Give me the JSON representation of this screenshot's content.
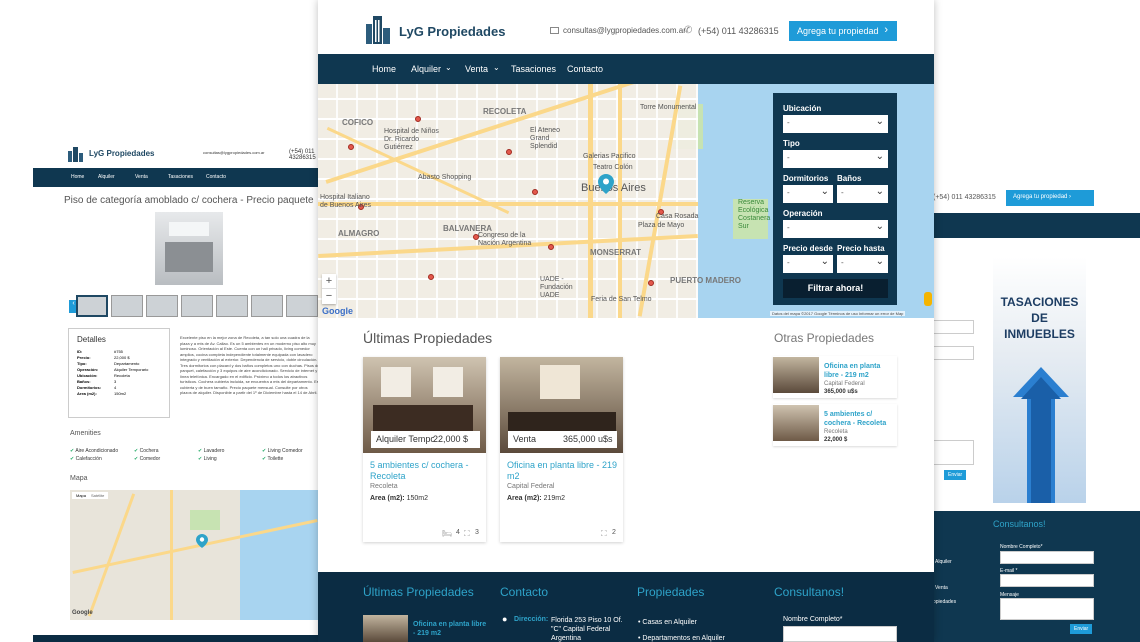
{
  "brand": {
    "name": "LyG Propiedades"
  },
  "header": {
    "email": "consultas@lygpropiedades.com.ar",
    "phone": "(+54) 011 43286315",
    "cta": "Agrega tu propiedad"
  },
  "nav": {
    "items": [
      "Home",
      "Alquiler",
      "Venta",
      "Tasaciones",
      "Contacto"
    ]
  },
  "search": {
    "ubicacion_label": "Ubicación",
    "tipo_label": "Tipo",
    "dormitorios_label": "Dormitorios",
    "banos_label": "Baños",
    "operacion_label": "Operación",
    "precio_desde_label": "Precio desde",
    "precio_hasta_label": "Precio hasta",
    "select_value": "-",
    "submit": "Filtrar ahora!"
  },
  "map": {
    "labels": [
      "Torre Monumental",
      "El Ateneo Grand Splendid",
      "Galerias Pacifico",
      "Teatro Colón",
      "RECOLETA",
      "Hospital de Niños Dr. Ricardo Gutiérrez",
      "Abasto Shopping",
      "Buenos Aires",
      "Casa Rosada",
      "Plaza de Mayo",
      "Congreso de la Nación Argentina",
      "BALVANERA",
      "ALMAGRO",
      "MONSERRAT",
      "UADE - Fundación UADE",
      "Feria de San Telmo",
      "COFICO",
      "Hospital Italiano de Buenos Aires",
      "PUERTO MADERO",
      "Reserva Ecológica Costanera Sur"
    ],
    "attribution": "Datos del mapa ©2017 Google  Términos de uso  Informar un error de Map",
    "google": "Google",
    "zoom_in": "+",
    "zoom_out": "−"
  },
  "latest": {
    "title": "Últimas Propiedades",
    "cards": [
      {
        "tag": "Alquiler Tempo",
        "price": "22,000 $",
        "title": "5 ambientes c/ cochera - Recoleta",
        "location": "Recoleta",
        "area_label": "Area (m2):",
        "area": "150m2",
        "beds": "4",
        "baths": "3"
      },
      {
        "tag": "Venta",
        "price": "365,000 u$s",
        "title": "Oficina en planta libre - 219 m2",
        "location": "Capital Federal",
        "area_label": "Area (m2):",
        "area": "219m2",
        "baths": "2"
      }
    ]
  },
  "others": {
    "title": "Otras Propiedades",
    "items": [
      {
        "title": "Oficina en planta libre - 219 m2",
        "location": "Capital Federal",
        "price": "365,000 u$s"
      },
      {
        "title": "5 ambientes c/ cochera - Recoleta",
        "location": "Recoleta",
        "price": "22,000 $"
      }
    ]
  },
  "footer": {
    "latest_title": "Últimas Propiedades",
    "contact_title": "Contacto",
    "props_title": "Propiedades",
    "consult_title": "Consultanos!",
    "latest_item": "Oficina en planta libre - 219 m2",
    "address_label": "Dirección:",
    "address": "Florida 253 Piso 10 Of. \"C\" Capital Federal Argentina",
    "props": [
      "Casas en Alquiler",
      "Departamentos en Alquiler"
    ],
    "name_label": "Nombre Completo*"
  },
  "left_page": {
    "title": "Piso de categoría amoblado c/ cochera - Precio paquete",
    "details_title": "Detalles",
    "details": [
      {
        "k": "ID:",
        "v": "#755"
      },
      {
        "k": "Precio:",
        "v": "22,000 $"
      },
      {
        "k": "Tipo:",
        "v": "Departamento"
      },
      {
        "k": "Operación:",
        "v": "Alquiler Temporario"
      },
      {
        "k": "Ubicación:",
        "v": "Recoleta"
      },
      {
        "k": "Baños:",
        "v": "3"
      },
      {
        "k": "Dormitorios:",
        "v": "4"
      },
      {
        "k": "Area (m2):",
        "v": "150m2"
      }
    ],
    "description": "Excelente piso en la mejor zona de Recoleta, a tan solo una cuadra de la plaza y a mts de Av. Callao. Es un 5 ambientes en un moderno piso alto muy luminoso. Orientación al Este. Cuenta con un hall privado, living comedor amplios, cocina completa independiente totalmente equipada con lavadero integrado y ventilación al exterior. Dependencia de servicio, doble circulación. Tres dormitorios con placard y dos baños completos uno con duchas. Pisos de parquet, calefacción y 3 equipos de aire acondicionado. Servicio de internet y línea telefónica. Encargado en el edificio. Próximo a todos los atractivos turísticos. Cochera cubierta incluida, se encuentra a mts del departamento. Es cubierta y de buen tamaño. Precio paquete mensual. Consulte por otros plazos de alquiler. Disponible a partir del 1º de Diciembre hasta el 14 de Abril.",
    "amenities_title": "Amenities",
    "amenities": [
      "Aire Acondicionado",
      "Cochera",
      "Lavadero",
      "Living Comedor",
      "Calefacción",
      "Comedor",
      "Living",
      "Toilette"
    ],
    "map_title": "Mapa",
    "map_tabs": [
      "Mapa",
      "Satélite"
    ]
  },
  "right_page": {
    "phone": "(+54) 011 43286315",
    "cta": "Agrega tu propiedad",
    "send": "Enviar",
    "banner_line1": "TASACIONES",
    "banner_line2": "DE",
    "banner_line3": "INMUEBLES",
    "consult_title": "Consultanos!",
    "nombre_label": "Nombre Completo*",
    "email_label": "E-mail *",
    "mensaje_label": "Mensaje",
    "footer_links": [
      "Alquiler",
      "Venta",
      "opiedades"
    ],
    "send2": "Enviar"
  }
}
